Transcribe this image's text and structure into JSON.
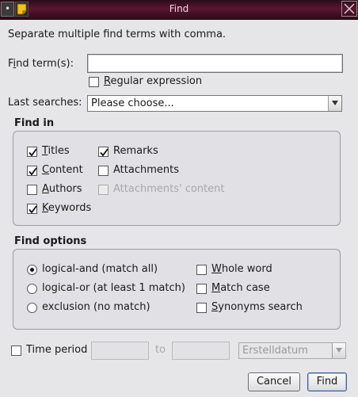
{
  "window": {
    "title": "Find",
    "menu_glyph": "•"
  },
  "intro": "Separate multiple find terms with comma.",
  "find_terms": {
    "label_mnemonic": "i",
    "label_rest_before": "F",
    "label_rest_after": "nd term(s):",
    "value": "",
    "regular_expression": {
      "mnemonic": "R",
      "rest": "egular expression",
      "checked": false
    }
  },
  "last_searches": {
    "label": "Last searches:",
    "selected": "Please choose..."
  },
  "find_in": {
    "title": "Find in",
    "titles": {
      "mnemonic": "T",
      "rest": "itles",
      "checked": true
    },
    "content": {
      "mnemonic": "C",
      "rest": "ontent",
      "checked": true
    },
    "authors": {
      "mnemonic": "A",
      "rest": "uthors",
      "checked": false
    },
    "keywords": {
      "mnemonic": "K",
      "rest": "eywords",
      "checked": true
    },
    "remarks": {
      "label": "Remarks",
      "checked": true
    },
    "attachments": {
      "label": "Attachments",
      "checked": false
    },
    "attachments_content": {
      "label": "Attachments' content",
      "checked": false,
      "enabled": false
    }
  },
  "find_options": {
    "title": "Find options",
    "logical_and": {
      "label": "logical-and (match all)",
      "selected": true
    },
    "logical_or": {
      "label": "logical-or (at least 1 match)",
      "selected": false
    },
    "exclusion": {
      "label": "exclusion (no match)",
      "selected": false
    },
    "whole_word": {
      "mnemonic": "W",
      "rest": "hole word",
      "checked": false
    },
    "match_case": {
      "mnemonic": "M",
      "rest": "atch case",
      "checked": false
    },
    "synonyms": {
      "mnemonic": "S",
      "rest": "ynonyms search",
      "checked": false
    }
  },
  "time_period": {
    "label": "Time period",
    "checked": false,
    "from": "",
    "to_label": "to",
    "to": "",
    "field": "Erstelldatum"
  },
  "buttons": {
    "cancel": "Cancel",
    "find": "Find"
  }
}
